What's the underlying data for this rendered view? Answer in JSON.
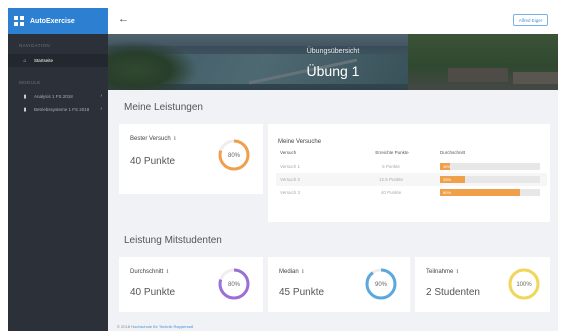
{
  "app": {
    "name": "AutoExercise"
  },
  "sidebar": {
    "navigation_heading": "NAVIGATION",
    "modules_heading": "MODULE",
    "items": [
      {
        "label": "Startseite",
        "icon": "home-icon"
      },
      {
        "label": "Analysis 1 FS 2018",
        "icon": "bookmark-icon"
      },
      {
        "label": "Betriebssysteme 1 FS 2018",
        "icon": "bookmark-icon"
      }
    ]
  },
  "topbar": {
    "back_icon": "back-arrow-icon",
    "user": "Alfred Eiger"
  },
  "banner": {
    "subtitle": "Übungsübersicht",
    "title": "Übung 1"
  },
  "my_performance": {
    "title": "Meine Leistungen",
    "best": {
      "label": "Bester Versuch",
      "value": "40 Punkte",
      "percent": 80,
      "percent_label": "80%",
      "color": "#f0a04b"
    },
    "attempts": {
      "title": "Meine Versuche",
      "headers": [
        "Versuch",
        "Erreichte Punkte",
        "Durchschnitt"
      ],
      "rows": [
        {
          "name": "Versuch 1",
          "points": "5 Punkte",
          "percent": 10,
          "percent_label": "10%"
        },
        {
          "name": "Versuch 2",
          "points": "12.5 Punkte",
          "percent": 25,
          "percent_label": "25%"
        },
        {
          "name": "Versuch 3",
          "points": "40 Punkte",
          "percent": 80,
          "percent_label": "80%"
        }
      ],
      "bar_color": "#f0a04b"
    }
  },
  "fellow_students": {
    "title": "Leistung Mitstudenten",
    "cards": [
      {
        "label": "Durchschnitt",
        "value": "40 Punkte",
        "percent": 80,
        "percent_label": "80%",
        "color": "#9b6fd6"
      },
      {
        "label": "Median",
        "value": "45 Punkte",
        "percent": 90,
        "percent_label": "90%",
        "color": "#5ba7e0"
      },
      {
        "label": "Teilnahme",
        "value": "2 Studenten",
        "percent": 100,
        "percent_label": "100%",
        "color": "#f2d65a"
      }
    ]
  },
  "footer": {
    "copyright": "© 2018",
    "link": "Hochschule für Technik Rapperswil"
  }
}
